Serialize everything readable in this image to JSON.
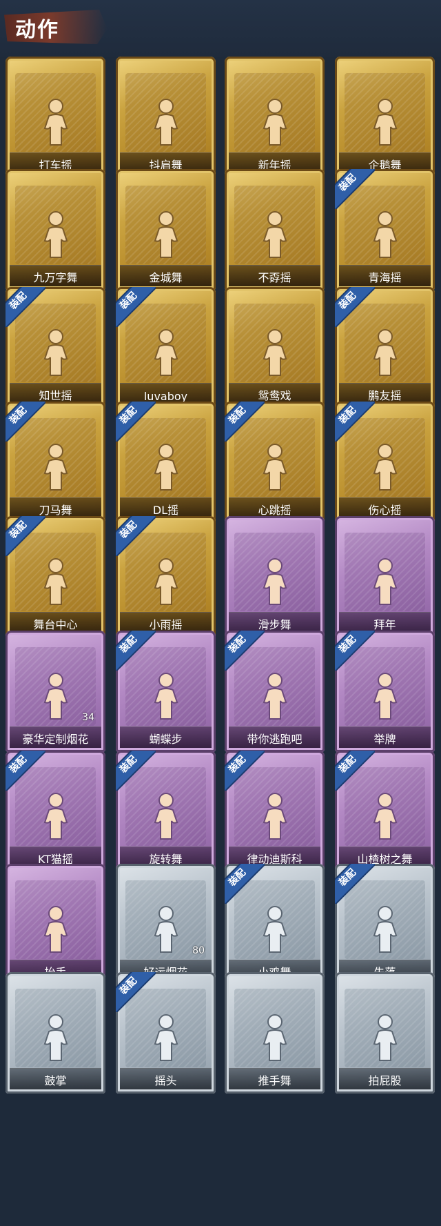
{
  "header": {
    "title": "动作"
  },
  "badge_text": "装配",
  "colors": {
    "gold": "#c9a340",
    "purple": "#a47cb8",
    "silver": "#aeb8c2",
    "badge": "#2f5fa8"
  },
  "items": [
    {
      "label": "打车摇",
      "tier": "gold",
      "equipped": false
    },
    {
      "label": "抖肩舞",
      "tier": "gold",
      "equipped": false
    },
    {
      "label": "新年摇",
      "tier": "gold",
      "equipped": false
    },
    {
      "label": "企鹅舞",
      "tier": "gold",
      "equipped": false
    },
    {
      "label": "九万字舞",
      "tier": "gold",
      "equipped": false
    },
    {
      "label": "金城舞",
      "tier": "gold",
      "equipped": false
    },
    {
      "label": "不孬摇",
      "tier": "gold",
      "equipped": false
    },
    {
      "label": "青海摇",
      "tier": "gold",
      "equipped": true
    },
    {
      "label": "知世摇",
      "tier": "gold",
      "equipped": true
    },
    {
      "label": "luvaboy",
      "tier": "gold",
      "equipped": true
    },
    {
      "label": "鸳鸯戏",
      "tier": "gold",
      "equipped": false
    },
    {
      "label": "鹏友摇",
      "tier": "gold",
      "equipped": true
    },
    {
      "label": "刀马舞",
      "tier": "gold",
      "equipped": true
    },
    {
      "label": "DL摇",
      "tier": "gold",
      "equipped": true
    },
    {
      "label": "心跳摇",
      "tier": "gold",
      "equipped": true
    },
    {
      "label": "伤心摇",
      "tier": "gold",
      "equipped": true
    },
    {
      "label": "舞台中心",
      "tier": "gold",
      "equipped": true
    },
    {
      "label": "小雨摇",
      "tier": "gold",
      "equipped": true
    },
    {
      "label": "滑步舞",
      "tier": "purple",
      "equipped": false
    },
    {
      "label": "拜年",
      "tier": "purple",
      "equipped": false
    },
    {
      "label": "豪华定制烟花",
      "tier": "purple",
      "equipped": false,
      "count": "34"
    },
    {
      "label": "蝴蝶步",
      "tier": "purple",
      "equipped": true
    },
    {
      "label": "带你逃跑吧",
      "tier": "purple",
      "equipped": true
    },
    {
      "label": "举牌",
      "tier": "purple",
      "equipped": true
    },
    {
      "label": "KT猫摇",
      "tier": "purple",
      "equipped": true
    },
    {
      "label": "旋转舞",
      "tier": "purple",
      "equipped": true
    },
    {
      "label": "律动迪斯科",
      "tier": "purple",
      "equipped": true
    },
    {
      "label": "山楂树之舞",
      "tier": "purple",
      "equipped": true
    },
    {
      "label": "抬手",
      "tier": "purple",
      "equipped": false
    },
    {
      "label": "好运烟花",
      "tier": "silver",
      "equipped": false,
      "count": "80"
    },
    {
      "label": "小鸡舞",
      "tier": "silver",
      "equipped": true
    },
    {
      "label": "失落",
      "tier": "silver",
      "equipped": true
    },
    {
      "label": "鼓掌",
      "tier": "silver",
      "equipped": false
    },
    {
      "label": "摇头",
      "tier": "silver",
      "equipped": true
    },
    {
      "label": "推手舞",
      "tier": "silver",
      "equipped": false
    },
    {
      "label": "拍屁股",
      "tier": "silver",
      "equipped": false
    }
  ]
}
